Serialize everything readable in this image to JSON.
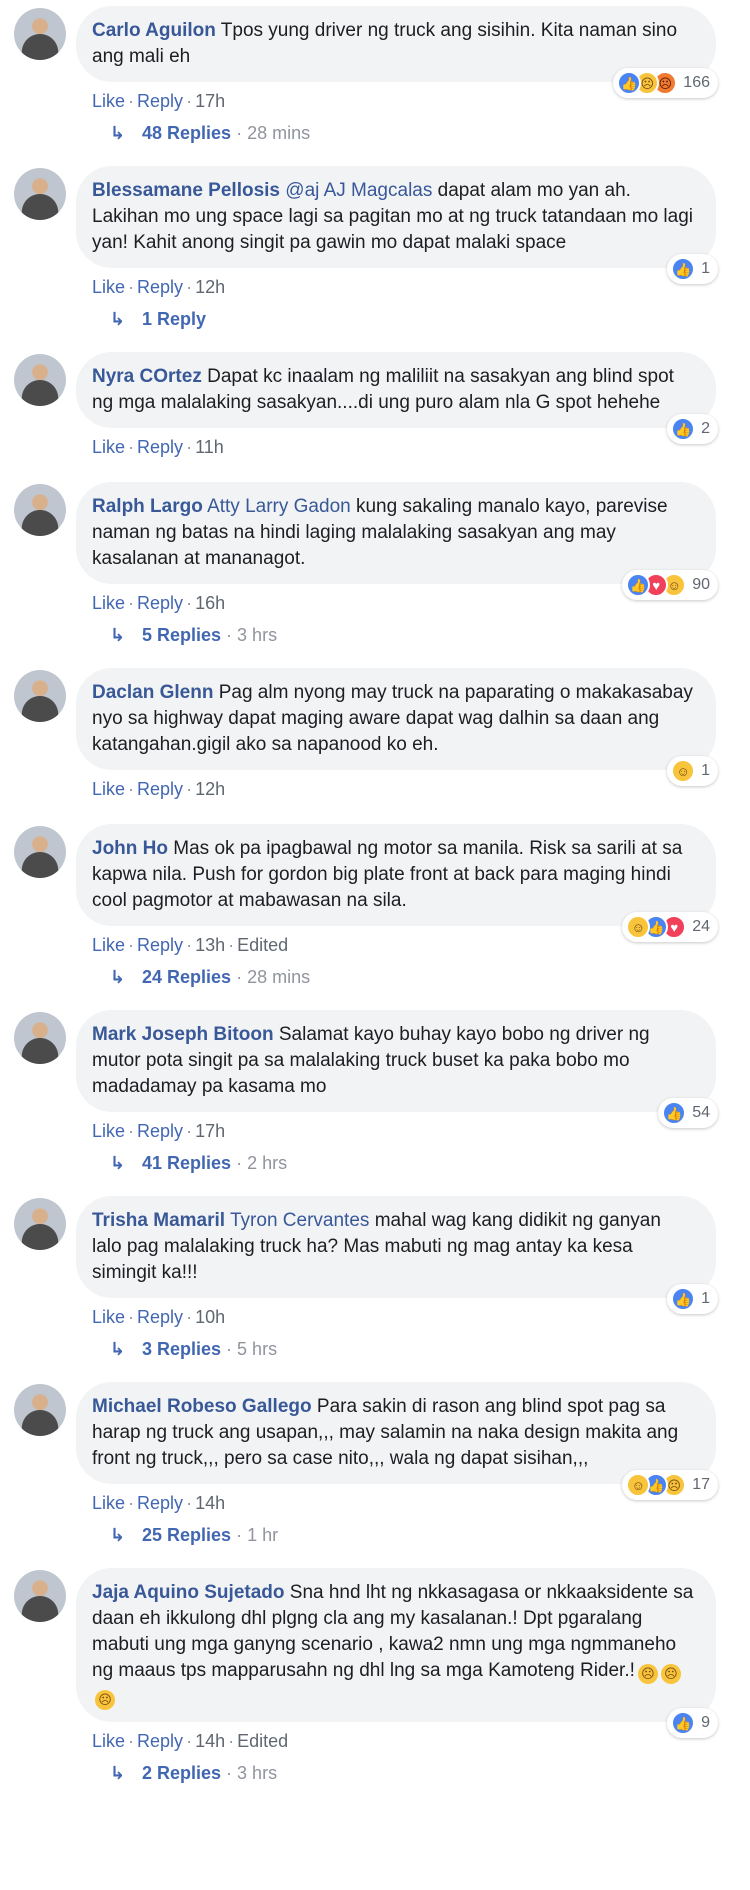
{
  "colors": {
    "bubble": "#f2f3f5",
    "author": "#385898",
    "link": "#4267b2",
    "meta": "#606770",
    "like": "#4a84f2",
    "love": "#f0405a",
    "yellow": "#f7c43c"
  },
  "labels": {
    "like": "Like",
    "reply": "Reply",
    "edited": "Edited"
  },
  "comments": [
    {
      "author": "Carlo Aguilon",
      "mention": "",
      "text": "Tpos yung driver ng truck ang sisihin. Kita naman sino ang mali eh",
      "time": "17h",
      "edited": false,
      "reactions": [
        "like-icon",
        "sad-icon",
        "angry-icon"
      ],
      "reaction_count": "166",
      "replies": {
        "label": "48 Replies",
        "time": "28 mins"
      }
    },
    {
      "author": "Blessamane Pellosis",
      "mention": "@aj AJ Magcalas",
      "text": "dapat alam mo yan ah. Lakihan mo ung space lagi sa pagitan mo at ng truck tatandaan mo lagi yan! Kahit anong singit pa gawin mo dapat malaki space",
      "time": "12h",
      "edited": false,
      "reactions": [
        "like-icon"
      ],
      "reaction_count": "1",
      "replies": {
        "label": "1 Reply",
        "time": ""
      }
    },
    {
      "author": "Nyra COrtez",
      "mention": "",
      "text": "Dapat kc inaalam ng maliliit na sasakyan ang blind spot ng mga malalaking sasakyan....di ung puro alam nla G spot hehehe",
      "time": "11h",
      "edited": false,
      "reactions": [
        "like-icon"
      ],
      "reaction_count": "2",
      "replies": null
    },
    {
      "author": "Ralph Largo",
      "mention": "Atty Larry Gadon",
      "text": "kung sakaling manalo kayo, parevise naman ng batas na hindi laging malalaking sasakyan ang may kasalanan at mananagot.",
      "time": "16h",
      "edited": false,
      "reactions": [
        "like-icon",
        "love-icon",
        "haha-icon"
      ],
      "reaction_count": "90",
      "replies": {
        "label": "5 Replies",
        "time": "3 hrs"
      }
    },
    {
      "author": "Daclan Glenn",
      "mention": "",
      "text": "Pag alm nyong may truck na paparating o makakasabay nyo sa highway dapat maging aware dapat wag dalhin sa daan ang katangahan.gigil ako sa napanood ko eh.",
      "time": "12h",
      "edited": false,
      "reactions": [
        "haha-icon"
      ],
      "reaction_count": "1",
      "replies": null
    },
    {
      "author": "John Ho",
      "mention": "",
      "text": "Mas ok pa ipagbawal ng motor sa manila. Risk sa sarili at sa kapwa nila. Push for gordon big plate front at back para maging hindi cool pagmotor at mabawasan na sila.",
      "time": "13h",
      "edited": true,
      "reactions": [
        "haha-icon",
        "like-icon",
        "love-icon"
      ],
      "reaction_count": "24",
      "replies": {
        "label": "24 Replies",
        "time": "28 mins"
      }
    },
    {
      "author": "Mark Joseph Bitoon",
      "mention": "",
      "text": "Salamat kayo buhay kayo bobo ng driver ng mutor pota singit pa sa malalaking truck buset ka paka bobo mo madadamay pa kasama mo",
      "time": "17h",
      "edited": false,
      "reactions": [
        "like-icon"
      ],
      "reaction_count": "54",
      "replies": {
        "label": "41 Replies",
        "time": "2 hrs"
      }
    },
    {
      "author": "Trisha Mamaril",
      "mention": "Tyron Cervantes",
      "text": "mahal wag kang didikit ng ganyan lalo pag malalaking truck ha? Mas mabuti ng mag antay ka kesa simingit ka!!!",
      "time": "10h",
      "edited": false,
      "reactions": [
        "like-icon"
      ],
      "reaction_count": "1",
      "replies": {
        "label": "3 Replies",
        "time": "5 hrs"
      }
    },
    {
      "author": "Michael Robeso Gallego",
      "mention": "",
      "text": "Para sakin di rason ang blind spot pag sa harap ng truck ang usapan,,, may salamin na naka design makita ang front ng truck,,, pero sa case nito,,, wala ng dapat sisihan,,,",
      "time": "14h",
      "edited": false,
      "reactions": [
        "haha-icon",
        "like-icon",
        "sad-icon"
      ],
      "reaction_count": "17",
      "replies": {
        "label": "25 Replies",
        "time": "1 hr"
      }
    },
    {
      "author": "Jaja Aquino Sujetado",
      "mention": "",
      "text": "Sna hnd lht ng nkkasagasa or nkkaaksidente sa daan eh ikkulong dhl plgng cla ang my kasalanan.! Dpt pgaralang mabuti ung mga ganyng scenario , kawa2 nmn ung mga ngmmaneho ng maaus tps mapparusahn ng dhl lng sa mga Kamoteng Rider.!",
      "emoji_inline": [
        "thinking-icon",
        "thinking-icon",
        "thinking-icon"
      ],
      "time": "14h",
      "edited": true,
      "reactions": [
        "like-icon"
      ],
      "reaction_count": "9",
      "replies": {
        "label": "2 Replies",
        "time": "3 hrs"
      }
    }
  ]
}
